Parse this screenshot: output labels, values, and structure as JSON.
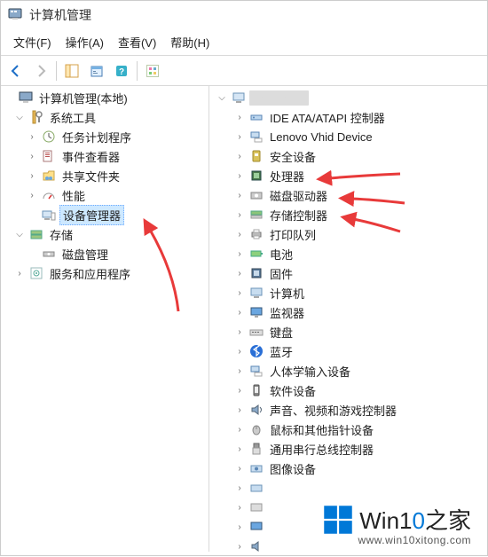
{
  "title": "计算机管理",
  "menu": {
    "file": "文件(F)",
    "action": "操作(A)",
    "view": "查看(V)",
    "help": "帮助(H)"
  },
  "left": {
    "root": "计算机管理(本地)",
    "system_tools": "系统工具",
    "task_scheduler": "任务计划程序",
    "event_viewer": "事件查看器",
    "shared_folders": "共享文件夹",
    "performance": "性能",
    "device_manager": "设备管理器",
    "storage": "存储",
    "disk_management": "磁盘管理",
    "services_apps": "服务和应用程序"
  },
  "right": {
    "ide": "IDE ATA/ATAPI 控制器",
    "lenovo": "Lenovo Vhid Device",
    "security": "安全设备",
    "cpu": "处理器",
    "disk": "磁盘驱动器",
    "storage_ctrl": "存储控制器",
    "print_queue": "打印队列",
    "battery": "电池",
    "firmware": "固件",
    "computer": "计算机",
    "monitor": "监视器",
    "keyboard": "键盘",
    "bluetooth": "蓝牙",
    "hid": "人体学输入设备",
    "software_dev": "软件设备",
    "sound": "声音、视频和游戏控制器",
    "mouse": "鼠标和其他指针设备",
    "usb": "通用串行总线控制器",
    "image": "图像设备"
  },
  "watermark": {
    "main1": "Win1",
    "main2": "0",
    "main3": "之家",
    "sub": "www.win10xitong.com"
  }
}
